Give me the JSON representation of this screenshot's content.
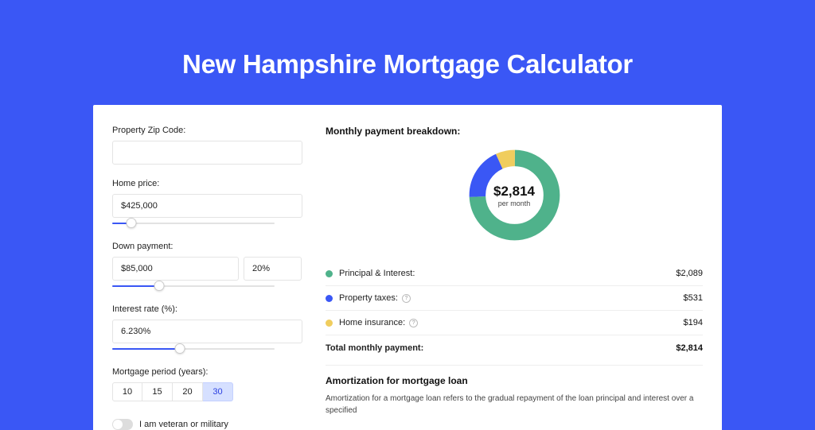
{
  "page_title": "New Hampshire Mortgage Calculator",
  "left_panel": {
    "zip": {
      "label": "Property Zip Code:",
      "value": ""
    },
    "home_price": {
      "label": "Home price:",
      "value": "$425,000",
      "slider_pct": 10
    },
    "down_payment": {
      "label": "Down payment:",
      "amount": "$85,000",
      "percent": "20%",
      "slider_pct": 24
    },
    "interest_rate": {
      "label": "Interest rate (%):",
      "value": "6.230%",
      "slider_pct": 35
    },
    "period": {
      "label": "Mortgage period (years):",
      "options": [
        "10",
        "15",
        "20",
        "30"
      ],
      "selected": "30"
    },
    "veteran": {
      "label": "I am veteran or military",
      "on": false
    }
  },
  "breakdown": {
    "title": "Monthly payment breakdown:",
    "center_value": "$2,814",
    "center_sub": "per month",
    "items": [
      {
        "label": "Principal & Interest:",
        "value": "$2,089",
        "color": "#4fb28b",
        "info": false
      },
      {
        "label": "Property taxes:",
        "value": "$531",
        "color": "#3a57f5",
        "info": true
      },
      {
        "label": "Home insurance:",
        "value": "$194",
        "color": "#f0cd5e",
        "info": true
      }
    ],
    "total": {
      "label": "Total monthly payment:",
      "value": "$2,814"
    }
  },
  "amortization": {
    "title": "Amortization for mortgage loan",
    "text": "Amortization for a mortgage loan refers to the gradual repayment of the loan principal and interest over a specified"
  },
  "chart_data": {
    "type": "pie",
    "title": "Monthly payment breakdown",
    "series": [
      {
        "name": "Principal & Interest",
        "value": 2089,
        "color": "#4fb28b"
      },
      {
        "name": "Property taxes",
        "value": 531,
        "color": "#3a57f5"
      },
      {
        "name": "Home insurance",
        "value": 194,
        "color": "#f0cd5e"
      }
    ],
    "total": 2814,
    "center_label": "$2,814 per month"
  }
}
